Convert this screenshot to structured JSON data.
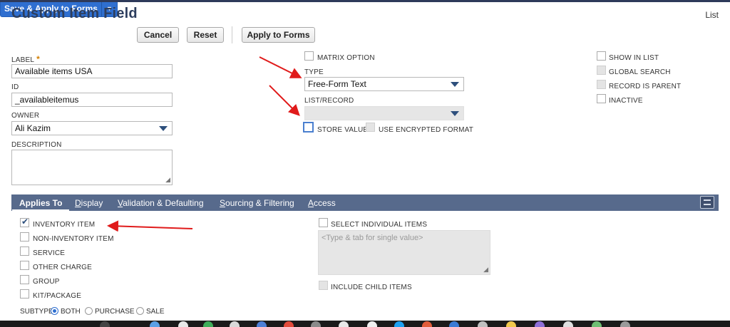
{
  "header": {
    "title": "Custom Item Field",
    "list_link": "List"
  },
  "toolbar": {
    "save_apply_label": "Save & Apply to Forms",
    "cancel_label": "Cancel",
    "reset_label": "Reset",
    "apply_label": "Apply to Forms"
  },
  "form": {
    "label_caption": "LABEL",
    "required_mark": "*",
    "label_value": "Available items USA",
    "id_caption": "ID",
    "id_value": "_availableitemus",
    "owner_caption": "OWNER",
    "owner_value": "Ali Kazim",
    "description_caption": "DESCRIPTION",
    "description_value": "",
    "matrix_option": "MATRIX OPTION",
    "type_caption": "TYPE",
    "type_value": "Free-Form Text",
    "list_record_caption": "LIST/RECORD",
    "list_record_value": "",
    "store_value": "STORE VALUE",
    "use_encrypted": "USE ENCRYPTED FORMAT",
    "show_in_list": "SHOW IN LIST",
    "global_search": "GLOBAL SEARCH",
    "record_is_parent": "RECORD IS PARENT",
    "inactive": "INACTIVE"
  },
  "tabs": [
    {
      "label": "Applies To",
      "active": true
    },
    {
      "label": "Display"
    },
    {
      "label": "Validation & Defaulting"
    },
    {
      "label": "Sourcing & Filtering"
    },
    {
      "label": "Access"
    }
  ],
  "applies_to": {
    "inventory_item": "INVENTORY ITEM",
    "non_inventory_item": "NON-INVENTORY ITEM",
    "service": "SERVICE",
    "other_charge": "OTHER CHARGE",
    "group": "GROUP",
    "kit_package": "KIT/PACKAGE",
    "subtype_caption": "SUBTYPE",
    "subtype_both": "BOTH",
    "subtype_purchase": "PURCHASE",
    "subtype_sale": "SALE",
    "subtype_selected": "BOTH",
    "select_individual": "SELECT INDIVIDUAL ITEMS",
    "individual_placeholder": "<Type & tab for single value>",
    "include_child": "INCLUDE CHILD ITEMS"
  },
  "colors": {
    "title": "#2d3e5e",
    "primary_button": "#2f6fd0",
    "tab_bar": "#576a8c",
    "annotation_arrow": "#e01b1b",
    "required": "#d37f00"
  },
  "icons": [
    "dropdown-caret-icon",
    "checkmark-icon",
    "radio-icon",
    "resize-grip-icon",
    "layout-toggle-icon",
    "red-arrow-icon"
  ]
}
